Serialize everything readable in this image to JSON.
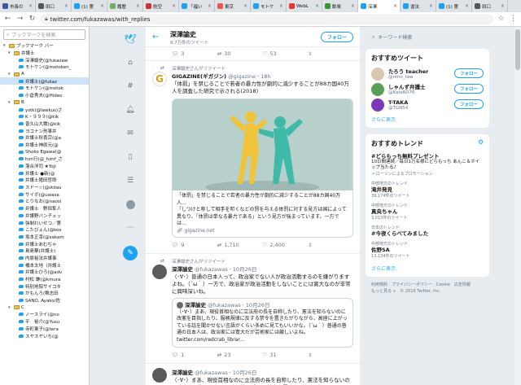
{
  "browser": {
    "tabs": [
      {
        "label": "市長の",
        "color": "#3b5998"
      },
      {
        "label": "田口",
        "color": "#555"
      },
      {
        "label": "(1) 第",
        "color": "#1da1f2"
      },
      {
        "label": "履歴",
        "color": "#7a6"
      },
      {
        "label": "航空",
        "color": "#c33"
      },
      {
        "label": "「福い",
        "color": "#1da1f2"
      },
      {
        "label": "東京",
        "color": "#e55"
      },
      {
        "label": "モトケ",
        "color": "#1da1f2"
      },
      {
        "label": "WebL",
        "color": "#e33"
      },
      {
        "label": "歓楽",
        "color": "#393"
      },
      {
        "label": "深澤",
        "color": "#1da1f2",
        "active": true
      },
      {
        "label": "違法",
        "color": "#1da1f2"
      },
      {
        "label": "(1) 第",
        "color": "#1da1f2"
      },
      {
        "label": "田口",
        "color": "#555"
      }
    ],
    "url": "twitter.com/fukazawas/with_replies"
  },
  "bookmarks": {
    "search_placeholder": "ブックマークを検索",
    "items": [
      {
        "label": "ブックマーク バー",
        "type": "folder",
        "indent": 1
      },
      {
        "label": "弁護士",
        "type": "folder",
        "indent": 2
      },
      {
        "label": "深澤諭史(@fukazaw",
        "type": "tw",
        "indent": 3
      },
      {
        "label": "モトケン(@motoken_",
        "type": "tw",
        "indent": 3
      },
      {
        "label": "A",
        "type": "folder",
        "indent": 2
      },
      {
        "label": "弁護士(@fukaz",
        "type": "tw",
        "indent": 3,
        "selected": true
      },
      {
        "label": "モトケン(@motok",
        "type": "tw",
        "indent": 3
      },
      {
        "label": "小倉秀夫(@Hideo",
        "type": "tw",
        "indent": 3
      },
      {
        "label": "B",
        "type": "folder",
        "indent": 2
      },
      {
        "label": "ystk(@lawkus)さ",
        "type": "tw",
        "indent": 3
      },
      {
        "label": "K・９９９(@kik",
        "type": "tw",
        "indent": 3
      },
      {
        "label": "普久山大爾(@kik",
        "type": "tw",
        "indent": 3
      },
      {
        "label": "ヨコナン刑事弁",
        "type": "tw",
        "indent": 3
      },
      {
        "label": "弁護士秋喜宗(@a",
        "type": "tw",
        "indent": 3
      },
      {
        "label": "弁護士神原元(@",
        "type": "tw",
        "indent": 3
      },
      {
        "label": "Shoko Egawa(@",
        "type": "tw",
        "indent": 3
      },
      {
        "label": "hzn行(@_hznf_さ",
        "type": "tw",
        "indent": 3
      },
      {
        "label": "落合洋司 ★Yoji",
        "type": "tw",
        "indent": 3
      },
      {
        "label": "弁護士 ●新(@",
        "type": "tw",
        "indent": 3
      },
      {
        "label": "弁護士猪田哲郎",
        "type": "tw",
        "indent": 3
      },
      {
        "label": "スドー☆(@stdau",
        "type": "tw",
        "indent": 3
      },
      {
        "label": "サイボ(@uwasa",
        "type": "tw",
        "indent": 3
      },
      {
        "label": "とりなお(@naosi",
        "type": "tw",
        "indent": 3
      },
      {
        "label": "弁護士　野田隼人",
        "type": "tw",
        "indent": 3
      },
      {
        "label": "弁護野バンチェッ",
        "type": "tw",
        "indent": 3
      },
      {
        "label": "強制わいせつ／第",
        "type": "tw",
        "indent": 3
      },
      {
        "label": "こたびょん(@kos",
        "type": "tw",
        "indent": 3
      },
      {
        "label": "坂本正幸(@sakam",
        "type": "tw",
        "indent": 3
      },
      {
        "label": "弁護士あむぢゃ",
        "type": "tw",
        "indent": 3
      },
      {
        "label": "島島華(弁護士)",
        "type": "tw",
        "indent": 3
      },
      {
        "label": "内原裕法弁護事",
        "type": "tw",
        "indent": 3
      },
      {
        "label": "橋本太地（弁護士",
        "type": "tw",
        "indent": 3
      },
      {
        "label": "弁護士ひろ(@adv",
        "type": "tw",
        "indent": 3
      },
      {
        "label": "村松 謙(@kmura",
        "type": "tw",
        "indent": 3
      },
      {
        "label": "特別地院サイコキ",
        "type": "tw",
        "indent": 3
      },
      {
        "label": "かもんろ(鴨志田",
        "type": "tw",
        "indent": 3
      },
      {
        "label": "SANO, Ayako/佐",
        "type": "tw",
        "indent": 3
      },
      {
        "label": "C",
        "type": "folder",
        "indent": 2
      },
      {
        "label": "ノースライ(@no",
        "type": "tw",
        "indent": 3
      },
      {
        "label": "平　裕介(@Yusu",
        "type": "tw",
        "indent": 3
      },
      {
        "label": "寺町東子(@tera",
        "type": "tw",
        "indent": 3
      },
      {
        "label": "スヤスヤいち(@",
        "type": "tw",
        "indent": 3
      }
    ]
  },
  "leftnav": {
    "icons": [
      "twitter-logo-icon",
      "home-icon",
      "hashtag-icon",
      "bell-icon",
      "mail-icon",
      "bookmark-icon",
      "list-icon",
      "profile-icon",
      "more-icon",
      "compose-icon"
    ]
  },
  "timeline": {
    "name": "深澤諭史",
    "tweet_count": "9.7万件のツイート",
    "follow_label": "フォロー",
    "top_actions": {
      "reply": "3",
      "retweet": "30",
      "like": "53"
    },
    "tweets": [
      {
        "retweet_note": "深澤諭史さんがリツイート",
        "author": "GIGAZINE(ギガジン)",
        "handle": "@gigazine",
        "time": "18h",
        "text": "「体罰」を禁じることで若者の暴力性が劇的に減少することが88カ国40万人を調査した研究で示される(2018)",
        "card_title": "「体罰」を禁じることで若者の暴力性が劇的に減少することが88カ国40万人…",
        "card_desc": "「しつけと称して相手を叩くなどの罰を与える体罰に対する見方は国によって異なり、「体罰は単なる暴力である」という見方が強まっています。一方では…",
        "card_url": "gigazine.net",
        "reply": "9",
        "retweet": "1,710",
        "like": "2,400"
      },
      {
        "retweet_note": "深澤諭史さんがリツイート",
        "author": "深澤諭史",
        "handle": "@fukazawas",
        "time": "10月26日",
        "text": "（･∀･）普通の日本人って、政治家でない人が政治活動するのを嫌がりますよね。（´ω｀）一方で、政治家が政治活動をしないことには寛大なのが非常に興味深いね。",
        "quote_author": "深澤諭史",
        "quote_handle": "@fukazawas",
        "quote_time": "10月26日",
        "quote_text": "（･∀･）まあ、現役首相なのに立法府の長を自称したり、憲法を知らないのに改憲を目指したり、服務規律に反する禁令を置きたがりながら、高座に上がっている話を聞かせない言語がくらい多めに見てもいいかな。（´ω｀）普通の普通の日本人は、政治家には寛大だが芸術家には厳しいよね。",
        "quote_url": "twitter.com/redcrab_librar…",
        "reply": "1",
        "retweet": "23",
        "like": "31"
      },
      {
        "author": "深澤諭史",
        "handle": "@fukazawas",
        "time": "10月26日",
        "text": "（･∀･）まあ、現役首相なのに立法府の長を自称したり、憲法を知らないのに改憲を目指したり、服務規律に反する禁令を置きたがりながら"
      }
    ]
  },
  "right": {
    "search_placeholder": "キーワード検索",
    "recommend_title": "おすすめツイート",
    "follow_label": "フォロー",
    "users": [
      {
        "name": "たろう teacher",
        "handle": "@nmo_taw",
        "color": "#d8c7b0"
      },
      {
        "name": "しゃんず弁護士",
        "handle": "@KatsAD76",
        "color": "#5a9e58"
      },
      {
        "name": "T-TAKA",
        "handle": "@TGN54",
        "color": "#7a3ab8"
      }
    ],
    "more_label": "さらに表示",
    "trends_title": "おすすめトレンド",
    "trends": [
      {
        "name": "#どらもっち無料プレゼント",
        "desc": "10日間連続／毎日1万名様にどらもっち あんこ＆ホイップ当たる♪",
        "promo": "ローソンによるプロモーション"
      },
      {
        "cat": "中部地方のトレンド",
        "name": "滝井発見",
        "count": "39,174件のツイート"
      },
      {
        "cat": "中部地方のトレンド",
        "name": "真央ちゃん",
        "count": "3,013件のツイート"
      },
      {
        "cat": "日本のトレンド",
        "name": "#今夜くらべてみました"
      },
      {
        "cat": "中部地方のトレンド",
        "name": "佐野SA",
        "count": "13,134件のツイート"
      }
    ],
    "trends_more": "さらに表示",
    "footer": [
      "利用規約",
      "プライバシーポリシー",
      "Cookie",
      "広告情報",
      "もっと見る ∨",
      "© 2019 Twitter, Inc."
    ]
  }
}
